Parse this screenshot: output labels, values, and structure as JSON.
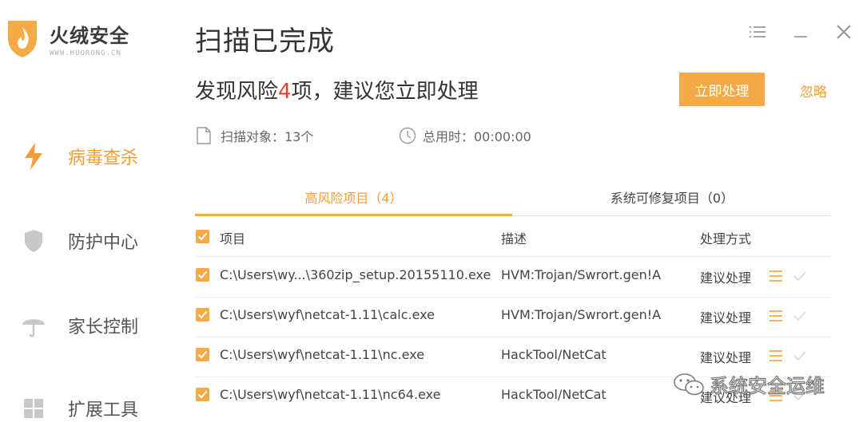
{
  "app": {
    "name": "火绒安全",
    "url": "WWW.HUORONG.CN",
    "accent_color": "#f5a947",
    "danger_color": "#e8432e"
  },
  "sidebar": {
    "items": [
      {
        "label": "病毒查杀",
        "icon": "lightning-icon",
        "active": true
      },
      {
        "label": "防护中心",
        "icon": "shield-icon",
        "active": false
      },
      {
        "label": "家长控制",
        "icon": "umbrella-icon",
        "active": false
      },
      {
        "label": "扩展工具",
        "icon": "grid-icon",
        "active": false
      }
    ]
  },
  "window": {
    "controls": [
      "menu-icon",
      "minimize-icon",
      "close-icon"
    ]
  },
  "main": {
    "title": "扫描已完成",
    "subtitle_prefix": "发现风险",
    "risk_count": "4",
    "subtitle_suffix": "项，建议您立即处理",
    "handle_button": "立即处理",
    "ignore_link": "忽略",
    "stats": {
      "scan_objects": "扫描对象：13个",
      "total_time": "总用时：00:00:00"
    },
    "tabs": [
      {
        "label": "高风险项目（4）",
        "active": true
      },
      {
        "label": "系统可修复项目（0）",
        "active": false
      }
    ],
    "table": {
      "columns": [
        "项目",
        "描述",
        "处理方式"
      ],
      "rows": [
        {
          "path": "C:\\Users\\wy...\\360zip_setup.20155110.exe",
          "desc": "HVM:Trojan/Swrort.gen!A",
          "action": "建议处理",
          "checked": true
        },
        {
          "path": "C:\\Users\\wyf\\netcat-1.11\\calc.exe",
          "desc": "HVM:Trojan/Swrort.gen!A",
          "action": "建议处理",
          "checked": true
        },
        {
          "path": "C:\\Users\\wyf\\netcat-1.11\\nc.exe",
          "desc": "HackTool/NetCat",
          "action": "建议处理",
          "checked": true
        },
        {
          "path": "C:\\Users\\wyf\\netcat-1.11\\nc64.exe",
          "desc": "HackTool/NetCat",
          "action": "建议处理",
          "checked": true
        }
      ]
    }
  },
  "watermark": {
    "text": "系统安全运维",
    "icon": "wechat-icon"
  }
}
